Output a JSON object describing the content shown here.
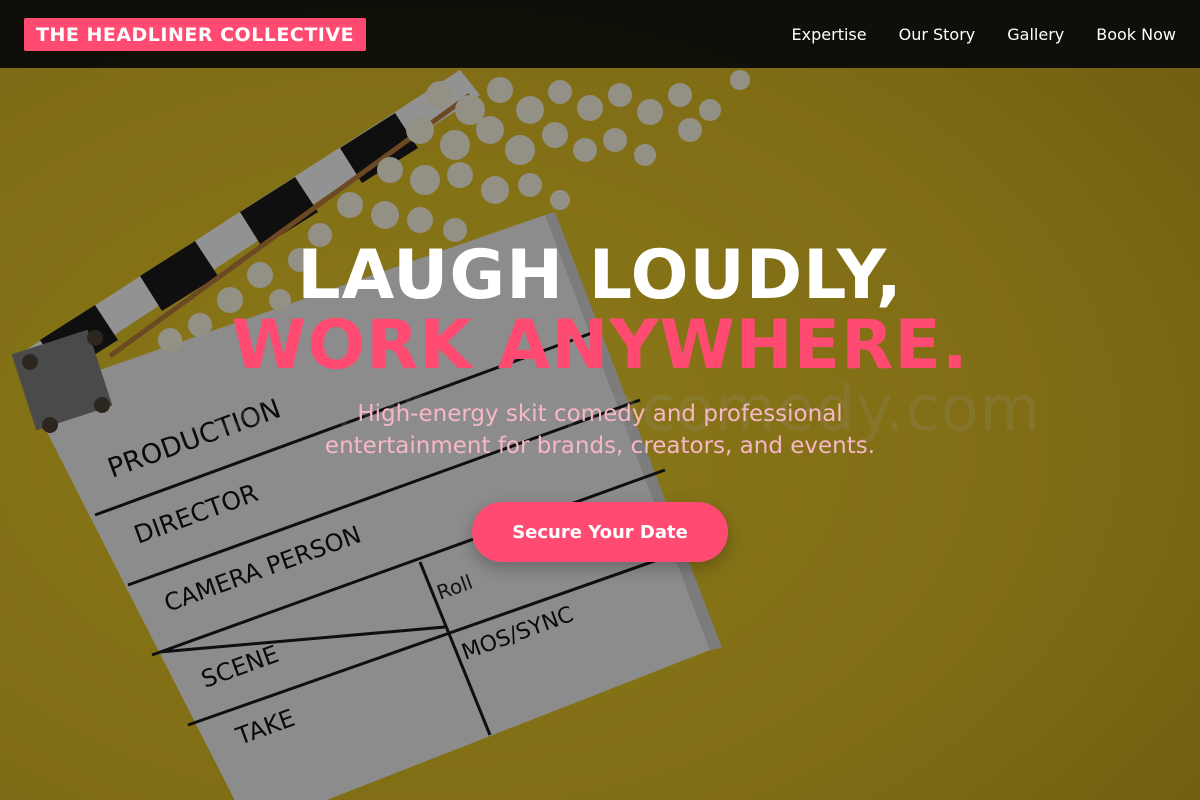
{
  "brand": {
    "name": "THE HEADLINER COLLECTIVE",
    "accent_color": "#ff4b72"
  },
  "nav": {
    "links": [
      {
        "label": "Expertise"
      },
      {
        "label": "Our Story"
      },
      {
        "label": "Gallery"
      },
      {
        "label": "Book Now"
      }
    ]
  },
  "hero": {
    "headline_line1": "LAUGH LOUDLY,",
    "headline_line2": "WORK ANYWHERE.",
    "subtitle": "High-energy skit comedy and professional entertainment for brands, creators, and events.",
    "cta_label": "Secure Your Date",
    "watermark": "workfromhomecomedy.com",
    "background_image": {
      "subject": "film clapperboard and popcorn on yellow background",
      "clapperboard_labels": [
        "PRODUCTION",
        "DIRECTOR",
        "CAMERA PERSON",
        "Roll",
        "SCENE",
        "MOS/SYNC",
        "TAKE"
      ],
      "colors": {
        "background": "#c9ad1f",
        "board": "#e9e9e9",
        "popcorn": "#f6f0df"
      }
    }
  }
}
